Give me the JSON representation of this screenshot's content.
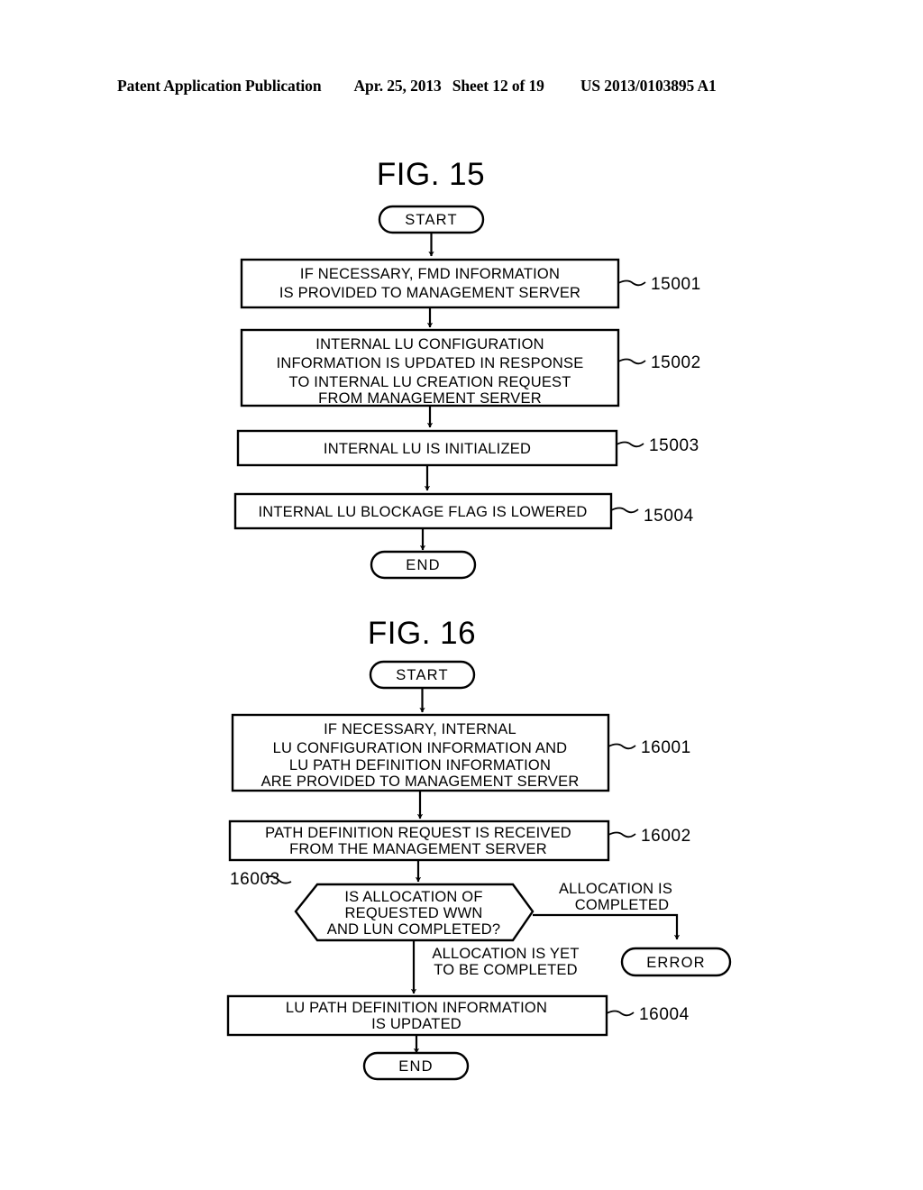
{
  "header": {
    "publication": "Patent Application Publication",
    "date": "Apr. 25, 2013",
    "sheet": "Sheet 12 of 19",
    "doc_number": "US 2013/0103895 A1"
  },
  "figures": [
    {
      "title": "FIG. 15",
      "start_label": "START",
      "end_label": "END",
      "steps": [
        {
          "ref": "15001",
          "lines": [
            "IF NECESSARY, FMD INFORMATION",
            "IS PROVIDED TO MANAGEMENT SERVER"
          ]
        },
        {
          "ref": "15002",
          "lines": [
            "INTERNAL LU CONFIGURATION",
            "INFORMATION IS UPDATED IN RESPONSE",
            "TO INTERNAL LU CREATION REQUEST",
            "FROM MANAGEMENT SERVER"
          ]
        },
        {
          "ref": "15003",
          "lines": [
            "INTERNAL LU IS INITIALIZED"
          ]
        },
        {
          "ref": "15004",
          "lines": [
            "INTERNAL LU BLOCKAGE FLAG IS LOWERED"
          ]
        }
      ]
    },
    {
      "title": "FIG. 16",
      "start_label": "START",
      "end_label": "END",
      "error_label": "ERROR",
      "steps": [
        {
          "ref": "16001",
          "lines": [
            "IF NECESSARY, INTERNAL",
            "LU CONFIGURATION INFORMATION AND",
            "LU PATH DEFINITION INFORMATION",
            "ARE PROVIDED TO MANAGEMENT SERVER"
          ]
        },
        {
          "ref": "16002",
          "lines": [
            "PATH DEFINITION REQUEST IS RECEIVED",
            "FROM THE MANAGEMENT SERVER"
          ]
        },
        {
          "ref": "16003",
          "lines": [
            "IS ALLOCATION OF",
            "REQUESTED WWN",
            "AND LUN COMPLETED?"
          ]
        },
        {
          "ref": "16004",
          "lines": [
            "LU PATH DEFINITION INFORMATION",
            "IS UPDATED"
          ]
        }
      ],
      "branches": {
        "yes_lines": [
          "ALLOCATION IS",
          "COMPLETED"
        ],
        "no_lines": [
          "ALLOCATION IS YET",
          "TO BE COMPLETED"
        ]
      }
    }
  ]
}
